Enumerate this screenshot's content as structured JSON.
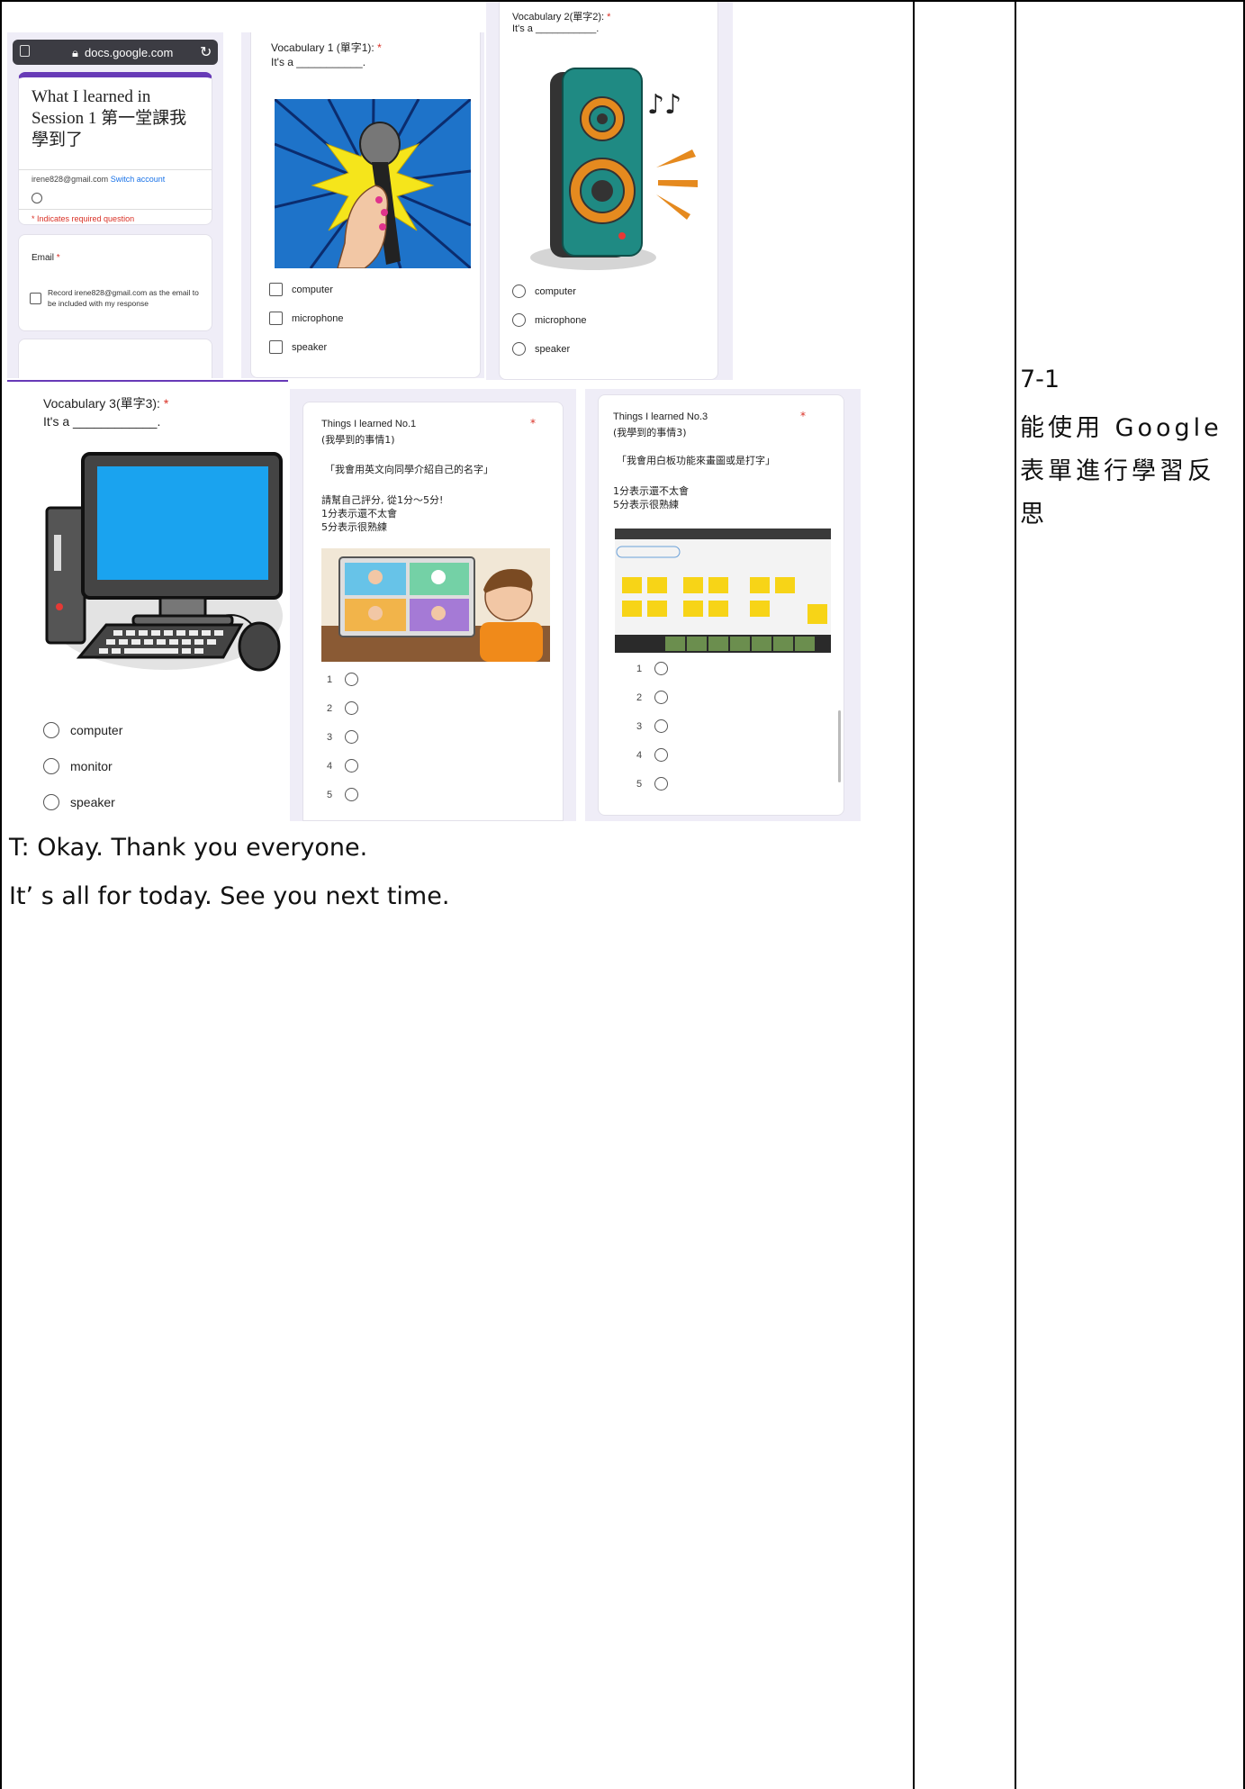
{
  "dialogue": {
    "line1": "T: Okay. Thank you everyone.",
    "line2": "It’ s all for today. See you next time."
  },
  "objective": {
    "code": "7-1",
    "text": "能使用 Google 表單進行學習反思"
  },
  "form_header": {
    "url": "docs.google.com",
    "title": "What I learned in Session 1 第一堂課我學到了",
    "account": "irene828@gmail.com",
    "switch": "Switch account",
    "required_note": "* Indicates required question",
    "email_label": "Email",
    "record_text": "Record irene828@gmail.com as the email to be included with my response"
  },
  "vocab1": {
    "title": "Vocabulary 1 (單字1):",
    "prompt": "It's a ___________.",
    "options": [
      "computer",
      "microphone",
      "speaker"
    ]
  },
  "vocab2": {
    "title": "Vocabulary 2(單字2):",
    "prompt": "It's a ___________.",
    "options": [
      "computer",
      "microphone",
      "speaker"
    ]
  },
  "vocab3": {
    "title": "Vocabulary 3(單字3):",
    "prompt": "It's a ____________.",
    "options": [
      "computer",
      "monitor",
      "speaker"
    ]
  },
  "learned1": {
    "title": "Things I learned No.1",
    "subtitle": "(我學到的事情1)",
    "statement": "「我會用英文向同學介紹自己的名字」",
    "instr1": "請幫自己評分, 從1分～5分!",
    "instr2": "1分表示還不太會",
    "instr3": "5分表示很熟練",
    "scale": [
      "1",
      "2",
      "3",
      "4",
      "5"
    ]
  },
  "learned3": {
    "title": "Things I learned No.3",
    "subtitle": "(我學到的事情3)",
    "statement": "「我會用白板功能來畫圖或是打字」",
    "instr1": "1分表示還不太會",
    "instr2": "5分表示很熟練",
    "scale": [
      "1",
      "2",
      "3",
      "4",
      "5"
    ]
  }
}
